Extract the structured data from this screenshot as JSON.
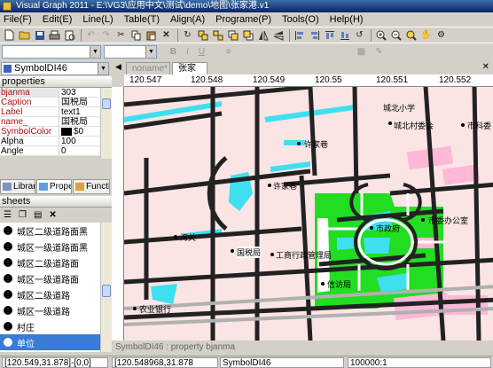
{
  "window": {
    "title": "Visual Graph 2011 - E:\\VG3\\应用中文\\测试\\demo\\地图\\张家港.v1"
  },
  "menu": [
    "File(F)",
    "Edit(E)",
    "Line(L)",
    "Table(T)",
    "Align(A)",
    "Programe(P)",
    "Tools(O)",
    "Help(H)"
  ],
  "toolbar_icons": [
    "new-icon",
    "open-icon",
    "save-icon",
    "print-icon",
    "preview-icon",
    "undo-icon",
    "redo-icon",
    "cut-icon",
    "copy-icon",
    "paste-icon",
    "delete-icon",
    "refresh-icon",
    "group-icon",
    "ungroup-icon",
    "front-icon",
    "back-icon",
    "flip-h-icon",
    "flip-v-icon",
    "align-left-icon",
    "align-right-icon",
    "align-top-icon",
    "align-bottom-icon",
    "rotate-icon",
    "zoom-in-icon",
    "zoom-out-icon",
    "zoom-fit-icon",
    "pan-icon",
    "settings-icon"
  ],
  "symbol_selector": {
    "value": "SymbolDI46"
  },
  "properties": {
    "header": "properties",
    "rows": [
      {
        "key": "bjanma",
        "value": "303"
      },
      {
        "key": "Caption",
        "value": "国税局"
      },
      {
        "key": "Label",
        "value": "text1"
      },
      {
        "key": "name_",
        "value": "国税局"
      },
      {
        "key": "SymbolColor",
        "value": "$0",
        "color": "#000000"
      },
      {
        "key": "Alpha",
        "value": "100"
      },
      {
        "key": "Angle",
        "value": "0"
      }
    ]
  },
  "panel_tabs": [
    "Librar",
    "Prope",
    "Functi"
  ],
  "sheets": {
    "header": "sheets",
    "items": [
      "城区二级道路面黑",
      "城区一级道路面黑",
      "城区二级道路面",
      "城区一级道路面",
      "城区二级道路",
      "城区一级道路",
      "村庄",
      "单位"
    ],
    "selected": "单位"
  },
  "doc_tabs": [
    {
      "label": "noname*",
      "active": false
    },
    {
      "label": "张家港*",
      "active": true
    }
  ],
  "ruler_labels": [
    "120.547",
    "120.548",
    "120.549",
    "120.55",
    "120.551",
    "120.552"
  ],
  "map_labels": [
    "城北小学",
    "城北村委会",
    "市科委",
    "许家巷",
    "许家巷",
    "市政府",
    "市委办公室",
    "海关",
    "国税局",
    "工商行政管理局",
    "信访局",
    "农业银行"
  ],
  "status": {
    "property_hint": "SymbolDI46 : property bjanma",
    "coord1": "[120.549,31.878]-[0,0]",
    "coord2": "[120.548968,31.878",
    "object": "SymbolDI46",
    "scale": "100000:1"
  }
}
